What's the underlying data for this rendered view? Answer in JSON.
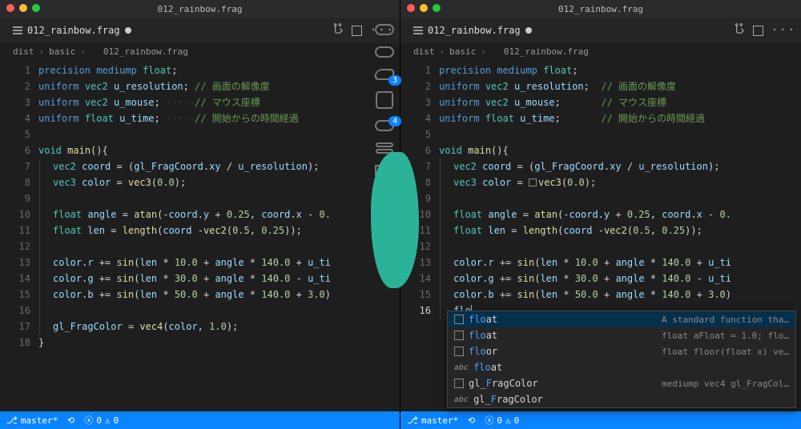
{
  "window_title": "012_rainbow.frag",
  "tab": {
    "label": "012_rainbow.frag"
  },
  "breadcrumb": {
    "part1": "dist",
    "part2": "basic",
    "part3": "012_rainbow.frag"
  },
  "badges": {
    "a": "3",
    "b": "4"
  },
  "left_code": {
    "lines": [
      {
        "n": "1",
        "ind": 1,
        "html": "<span class='kw'>precision</span> <span class='kw'>mediump</span> <span class='type'>float</span><span class='op'>;</span>"
      },
      {
        "n": "2",
        "ind": 1,
        "html": "<span class='kw'>uniform</span> <span class='type'>vec2</span> <span class='id'>u_resolution</span><span class='op'>;</span> <span class='cmt'>// 画面の解像度</span>"
      },
      {
        "n": "3",
        "ind": 1,
        "html": "<span class='kw'>uniform</span> <span class='type'>vec2</span> <span class='id'>u_mouse</span><span class='op'>;</span><span class='ws-dot'>······</span><span class='cmt'>// マウス座標</span>"
      },
      {
        "n": "4",
        "ind": 1,
        "html": "<span class='kw'>uniform</span> <span class='type'>float</span> <span class='id'>u_time</span><span class='op'>;</span><span class='ws-dot'>······</span><span class='cmt'>// 開始からの時間経過</span>"
      },
      {
        "n": "5",
        "ind": 1,
        "html": ""
      },
      {
        "n": "6",
        "ind": 1,
        "html": "<span class='type'>void</span> <span class='fn'>main</span><span class='op'>()</span><span class='op'>{</span>"
      },
      {
        "n": "7",
        "ind": 2,
        "html": "<span class='type'>vec2</span> <span class='id'>coord</span> <span class='op'>= (</span><span class='id'>gl_FragCoord</span><span class='op'>.</span><span class='id'>xy</span> <span class='op'>/</span> <span class='id'>u_resolution</span><span class='op'>);</span>"
      },
      {
        "n": "8",
        "ind": 2,
        "html": "<span class='type'>vec3</span> <span class='id'>color</span> <span class='op'>=</span> <span class='fn'>vec3</span><span class='op'>(</span><span class='num'>0.0</span><span class='op'>);</span>"
      },
      {
        "n": "9",
        "ind": 2,
        "html": ""
      },
      {
        "n": "10",
        "ind": 2,
        "html": "<span class='type'>float</span> <span class='id'>angle</span> <span class='op'>=</span> <span class='fn'>atan</span><span class='op'>(-</span><span class='id'>coord</span><span class='op'>.</span><span class='id'>y</span> <span class='op'>+</span> <span class='num'>0.25</span><span class='op'>,</span> <span class='id'>coord</span><span class='op'>.</span><span class='id'>x</span> <span class='op'>-</span> <span class='num'>0.</span>"
      },
      {
        "n": "11",
        "ind": 2,
        "html": "<span class='type'>float</span> <span class='id'>len</span> <span class='op'>=</span> <span class='fn'>length</span><span class='op'>(</span><span class='id'>coord</span> <span class='op'>-</span><span class='fn'>vec2</span><span class='op'>(</span><span class='num'>0.5</span><span class='op'>,</span> <span class='num'>0.25</span><span class='op'>));</span>"
      },
      {
        "n": "12",
        "ind": 2,
        "html": ""
      },
      {
        "n": "13",
        "ind": 2,
        "html": "<span class='id'>color</span><span class='op'>.</span><span class='id'>r</span> <span class='op'>+=</span> <span class='fn'>sin</span><span class='op'>(</span><span class='id'>len</span> <span class='op'>*</span> <span class='num'>10.0</span> <span class='op'>+</span> <span class='id'>angle</span> <span class='op'>*</span> <span class='num'>140.0</span> <span class='op'>+</span> <span class='id'>u_ti</span>"
      },
      {
        "n": "14",
        "ind": 2,
        "html": "<span class='id'>color</span><span class='op'>.</span><span class='id'>g</span> <span class='op'>+=</span> <span class='fn'>sin</span><span class='op'>(</span><span class='id'>len</span> <span class='op'>*</span> <span class='num'>30.0</span> <span class='op'>+</span> <span class='id'>angle</span> <span class='op'>*</span> <span class='num'>140.0</span> <span class='op'>-</span> <span class='id'>u_ti</span>"
      },
      {
        "n": "15",
        "ind": 2,
        "html": "<span class='id'>color</span><span class='op'>.</span><span class='id'>b</span> <span class='op'>+=</span> <span class='fn'>sin</span><span class='op'>(</span><span class='id'>len</span> <span class='op'>*</span> <span class='num'>50.0</span> <span class='op'>+</span> <span class='id'>angle</span> <span class='op'>*</span> <span class='num'>140.0</span> <span class='op'>+</span> <span class='num'>3.0</span><span class='op'>)</span>"
      },
      {
        "n": "16",
        "ind": 2,
        "html": ""
      },
      {
        "n": "17",
        "ind": 2,
        "html": "<span class='id'>gl_FragColor</span> <span class='op'>=</span> <span class='fn'>vec4</span><span class='op'>(</span><span class='id'>color</span><span class='op'>,</span> <span class='num'>1.0</span><span class='op'>);</span>"
      },
      {
        "n": "18",
        "ind": 1,
        "html": "<span class='op'>}</span>"
      }
    ]
  },
  "right_code": {
    "lines": [
      {
        "n": "1",
        "ind": 1,
        "html": "<span class='kw'>precision</span> <span class='kw'>mediump</span> <span class='type'>float</span><span class='op'>;</span>"
      },
      {
        "n": "2",
        "ind": 1,
        "html": "<span class='kw'>uniform</span> <span class='type'>vec2</span> <span class='id'>u_resolution</span><span class='op'>;</span>  <span class='cmt'>// 画面の解像度</span>"
      },
      {
        "n": "3",
        "ind": 1,
        "html": "<span class='kw'>uniform</span> <span class='type'>vec2</span> <span class='id'>u_mouse</span><span class='op'>;</span>       <span class='cmt'>// マウス座標</span>"
      },
      {
        "n": "4",
        "ind": 1,
        "html": "<span class='kw'>uniform</span> <span class='type'>float</span> <span class='id'>u_time</span><span class='op'>;</span>       <span class='cmt'>// 開始からの時間経過</span>"
      },
      {
        "n": "5",
        "ind": 1,
        "html": ""
      },
      {
        "n": "6",
        "ind": 1,
        "html": "<span class='type'>void</span> <span class='fn'>main</span><span class='op'>()</span><span class='op'>{</span>"
      },
      {
        "n": "7",
        "ind": 2,
        "html": "<span class='type'>vec2</span> <span class='id'>coord</span> <span class='op'>= (</span><span class='id'>gl_FragCoord</span><span class='op'>.</span><span class='id'>xy</span> <span class='op'>/</span> <span class='id'>u_resolution</span><span class='op'>);</span>"
      },
      {
        "n": "8",
        "ind": 2,
        "html": "<span class='type'>vec3</span> <span class='id'>color</span> <span class='op'>=</span> <span class='selbox'></span><span class='fn'>vec3</span><span class='op'>(</span><span class='num'>0.0</span><span class='op'>);</span>"
      },
      {
        "n": "9",
        "ind": 2,
        "html": ""
      },
      {
        "n": "10",
        "ind": 2,
        "html": "<span class='type'>float</span> <span class='id'>angle</span> <span class='op'>=</span> <span class='fn'>atan</span><span class='op'>(-</span><span class='id'>coord</span><span class='op'>.</span><span class='id'>y</span> <span class='op'>+</span> <span class='num'>0.25</span><span class='op'>,</span> <span class='id'>coord</span><span class='op'>.</span><span class='id'>x</span> <span class='op'>-</span> <span class='num'>0.</span>"
      },
      {
        "n": "11",
        "ind": 2,
        "html": "<span class='type'>float</span> <span class='id'>len</span> <span class='op'>=</span> <span class='fn'>length</span><span class='op'>(</span><span class='id'>coord</span> <span class='op'>-</span><span class='fn'>vec2</span><span class='op'>(</span><span class='num'>0.5</span><span class='op'>,</span> <span class='num'>0.25</span><span class='op'>));</span>"
      },
      {
        "n": "12",
        "ind": 2,
        "html": ""
      },
      {
        "n": "13",
        "ind": 2,
        "html": "<span class='id'>color</span><span class='op'>.</span><span class='id'>r</span> <span class='op'>+=</span> <span class='fn'>sin</span><span class='op'>(</span><span class='id'>len</span> <span class='op'>*</span> <span class='num'>10.0</span> <span class='op'>+</span> <span class='id'>angle</span> <span class='op'>*</span> <span class='num'>140.0</span> <span class='op'>+</span> <span class='id'>u_ti</span>"
      },
      {
        "n": "14",
        "ind": 2,
        "html": "<span class='id'>color</span><span class='op'>.</span><span class='id'>g</span> <span class='op'>+=</span> <span class='fn'>sin</span><span class='op'>(</span><span class='id'>len</span> <span class='op'>*</span> <span class='num'>30.0</span> <span class='op'>+</span> <span class='id'>angle</span> <span class='op'>*</span> <span class='num'>140.0</span> <span class='op'>-</span> <span class='id'>u_ti</span>"
      },
      {
        "n": "15",
        "ind": 2,
        "html": "<span class='id'>color</span><span class='op'>.</span><span class='id'>b</span> <span class='op'>+=</span> <span class='fn'>sin</span><span class='op'>(</span><span class='id'>len</span> <span class='op'>*</span> <span class='num'>50.0</span> <span class='op'>+</span> <span class='id'>angle</span> <span class='op'>*</span> <span class='num'>140.0</span> <span class='op'>+</span> <span class='num'>3.0</span><span class='op'>)</span>"
      },
      {
        "n": "16",
        "ind": 2,
        "active": true,
        "html": "<span class='id'>flo</span><span class='cursor'></span>"
      }
    ]
  },
  "suggest": {
    "items": [
      {
        "icon": "kind",
        "label_hl": "flo",
        "label_rest": "at",
        "doc": "A standard function tha…",
        "selected": true
      },
      {
        "icon": "kind",
        "label_hl": "flo",
        "label_rest": "at",
        "doc": "float aFloat = 1.0; flo…"
      },
      {
        "icon": "kind",
        "label_hl": "flo",
        "label_rest": "or",
        "doc": "float floor(float x) ve…"
      },
      {
        "icon": "abc",
        "label_hl": "flo",
        "label_rest": "at",
        "doc": ""
      },
      {
        "icon": "kind",
        "label_pre": "gl_",
        "label_hl": "F",
        "label_rest": "ragColor",
        "doc": "mediump vec4 gl_FragCol…"
      },
      {
        "icon": "abc",
        "label_pre": "gl_",
        "label_hl": "F",
        "label_rest": "ragColor",
        "doc": ""
      }
    ]
  },
  "status": {
    "branch": "master*",
    "errors": "0",
    "warnings": "0"
  }
}
